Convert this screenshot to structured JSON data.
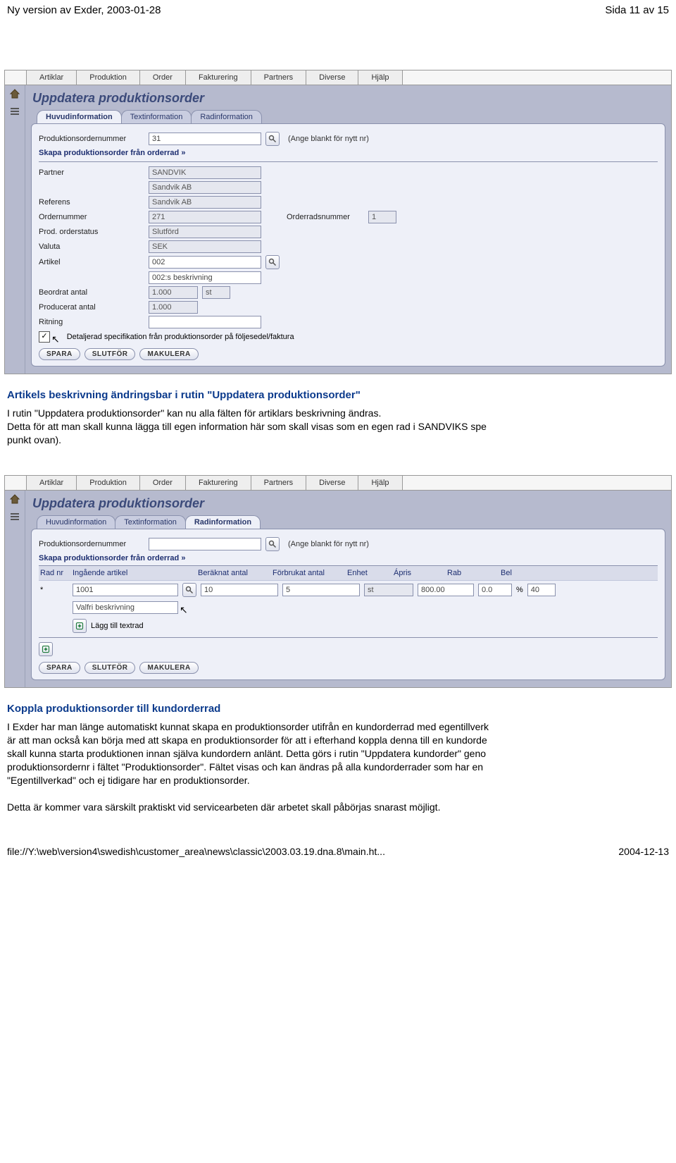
{
  "header": {
    "left": "Ny version av Exder, 2003-01-28",
    "right": "Sida 11 av 15"
  },
  "menu": [
    "Artiklar",
    "Produktion",
    "Order",
    "Fakturering",
    "Partners",
    "Diverse",
    "Hjälp"
  ],
  "window1": {
    "title": "Uppdatera produktionsorder",
    "tabs": [
      "Huvudinformation",
      "Textinformation",
      "Radinformation"
    ],
    "activeTab": 0,
    "fields": {
      "prodOrderNrLabel": "Produktionsordernummer",
      "prodOrderNr": "31",
      "blankNote": "(Ange blankt för nytt nr)",
      "skapaLink": "Skapa produktionsorder från orderrad »",
      "partnerLabel": "Partner",
      "partnerCode": "SANDVIK",
      "partnerName": "Sandvik AB",
      "referensLabel": "Referens",
      "referens": "Sandvik AB",
      "ordernummerLabel": "Ordernummer",
      "ordernummer": "271",
      "orderradsnummerLabel": "Orderradsnummer",
      "orderradsnummer": "1",
      "orderstatusLabel": "Prod. orderstatus",
      "orderstatus": "Slutförd",
      "valutaLabel": "Valuta",
      "valuta": "SEK",
      "artikelLabel": "Artikel",
      "artikel": "002",
      "artikelDesc": "002:s beskrivning",
      "beordratLabel": "Beordrat antal",
      "beordrat": "1.000",
      "beordratUnit": "st",
      "produceratLabel": "Producerat antal",
      "producerat": "1.000",
      "ritningLabel": "Ritning",
      "detaljCheckLabel": "Detaljerad specifikation från produktionsorder på följesedel/faktura"
    },
    "buttons": [
      "SPARA",
      "SLUTFÖR",
      "MAKULERA"
    ]
  },
  "article_between": {
    "heading": "Artikels beskrivning ändringsbar i rutin \"Uppdatera produktionsorder\"",
    "p1": "I rutin \"Uppdatera produktionsorder\" kan nu alla fälten för artiklars beskrivning ändras.",
    "p2": "Detta för att man skall kunna lägga till egen information här som skall visas som en egen rad i SANDVIKS spe",
    "p3": "punkt ovan)."
  },
  "window2": {
    "title": "Uppdatera produktionsorder",
    "tabs": [
      "Huvudinformation",
      "Textinformation",
      "Radinformation"
    ],
    "activeTab": 2,
    "fields": {
      "prodOrderNrLabel": "Produktionsordernummer",
      "prodOrderNr": "",
      "blankNote": "(Ange blankt för nytt nr)",
      "skapaLink": "Skapa produktionsorder från orderrad »"
    },
    "columns": {
      "rad": "Rad nr",
      "art": "Ingående artikel",
      "berk": "Beräknat antal",
      "forb": "Förbrukat antal",
      "enh": "Enhet",
      "apris": "Ápris",
      "rab": "Rab",
      "bel": "Bel"
    },
    "line": {
      "rad": "*",
      "art": "1001",
      "desc": "Valfri beskrivning",
      "berk": "10",
      "forb": "5",
      "enh": "st",
      "apris": "800.00",
      "rab": "0.0",
      "rabUnit": "%",
      "bel": "40"
    },
    "laggText": "Lägg till textrad",
    "buttons": [
      "SPARA",
      "SLUTFÖR",
      "MAKULERA"
    ]
  },
  "article_after": {
    "heading": "Koppla produktionsorder till kundorderrad",
    "p1": "I Exder har man länge automatiskt kunnat skapa en produktionsorder utifrån en kundorderrad med egentillverk",
    "p2": "är att man också kan börja med att skapa en produktionsorder för att i efterhand koppla denna till en kundorde",
    "p3": "skall kunna starta produktionen innan själva kundordern anlänt. Detta görs i rutin \"Uppdatera kundorder\" geno",
    "p4": "produktionsordernr i fältet \"Produktionsorder\". Fältet visas och kan ändras på alla kundorderrader som har en",
    "p5": "\"Egentillverkad\" och ej tidigare har en produktionsorder.",
    "p6": "Detta är kommer vara särskilt praktiskt vid servicearbeten där arbetet skall påbörjas snarast möjligt."
  },
  "footer": {
    "left": "file://Y:\\web\\version4\\swedish\\customer_area\\news\\classic\\2003.03.19.dna.8\\main.ht...",
    "right": "2004-12-13"
  }
}
